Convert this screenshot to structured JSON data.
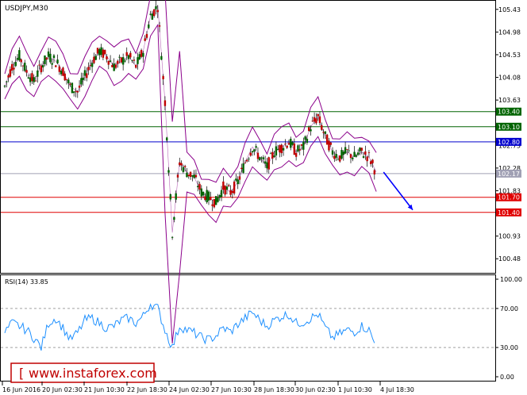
{
  "chart_data": [
    {
      "type": "candlestick",
      "title": "USDJPY,M30",
      "ylim": [
        100.2,
        105.6
      ],
      "y_ticks": [
        "105.43",
        "104.98",
        "104.53",
        "104.08",
        "103.63",
        "102.73",
        "102.28",
        "101.83",
        "100.93",
        "100.48"
      ],
      "price_levels": [
        {
          "label": "103.40",
          "value": 103.4,
          "role": "resistance",
          "color": "#006400"
        },
        {
          "label": "103.10",
          "value": 103.1,
          "role": "resistance",
          "color": "#006400"
        },
        {
          "label": "102.80",
          "value": 102.8,
          "role": "pivot",
          "color": "#0000cd"
        },
        {
          "label": "102.17",
          "value": 102.17,
          "role": "current",
          "color": "#a0a0b4"
        },
        {
          "label": "101.70",
          "value": 101.7,
          "role": "support",
          "color": "#e00000"
        },
        {
          "label": "101.40",
          "value": 101.4,
          "role": "support",
          "color": "#e00000"
        }
      ],
      "close_path": [
        [
          0,
          103.9
        ],
        [
          1,
          104.3
        ],
        [
          2,
          104.5
        ],
        [
          3,
          104.2
        ],
        [
          4,
          104.0
        ],
        [
          5,
          104.3
        ],
        [
          6,
          104.5
        ],
        [
          7,
          104.4
        ],
        [
          8,
          104.2
        ],
        [
          9,
          103.9
        ],
        [
          10,
          103.8
        ],
        [
          11,
          104.1
        ],
        [
          12,
          104.4
        ],
        [
          13,
          104.6
        ],
        [
          14,
          104.5
        ],
        [
          15,
          104.3
        ],
        [
          16,
          104.4
        ],
        [
          17,
          104.5
        ],
        [
          18,
          104.3
        ],
        [
          19,
          104.6
        ],
        [
          20,
          105.3
        ],
        [
          21,
          105.5
        ],
        [
          22,
          103.6
        ],
        [
          23,
          101.0
        ],
        [
          24,
          102.4
        ],
        [
          25,
          102.2
        ],
        [
          26,
          102.1
        ],
        [
          27,
          101.8
        ],
        [
          28,
          101.7
        ],
        [
          29,
          101.6
        ],
        [
          30,
          101.9
        ],
        [
          31,
          101.8
        ],
        [
          32,
          102.0
        ],
        [
          33,
          102.4
        ],
        [
          34,
          102.7
        ],
        [
          35,
          102.5
        ],
        [
          36,
          102.3
        ],
        [
          37,
          102.6
        ],
        [
          38,
          102.7
        ],
        [
          39,
          102.8
        ],
        [
          40,
          102.6
        ],
        [
          41,
          102.7
        ],
        [
          42,
          103.1
        ],
        [
          43,
          103.3
        ],
        [
          44,
          102.9
        ],
        [
          45,
          102.6
        ],
        [
          46,
          102.5
        ],
        [
          47,
          102.6
        ],
        [
          48,
          102.5
        ],
        [
          49,
          102.6
        ],
        [
          50,
          102.5
        ],
        [
          51,
          102.2
        ]
      ],
      "forecast_arrow": {
        "from": [
          52,
          102.2
        ],
        "to": [
          56,
          101.45
        ],
        "color": "#0000ff"
      },
      "indicator": "Bollinger Bands",
      "band_color": "#8b008b"
    },
    {
      "type": "line",
      "title": "RSI(14) 33.85",
      "ylim": [
        0,
        100
      ],
      "y_ticks": [
        "100.00",
        "70.00",
        "30.00",
        "0.00"
      ],
      "levels": [
        70,
        30
      ],
      "values": [
        45,
        55,
        52,
        48,
        40,
        30,
        55,
        60,
        50,
        38,
        45,
        58,
        60,
        55,
        50,
        52,
        58,
        60,
        55,
        62,
        75,
        70,
        48,
        30,
        52,
        48,
        45,
        40,
        38,
        42,
        50,
        46,
        54,
        60,
        66,
        58,
        52,
        58,
        62,
        64,
        55,
        56,
        60,
        64,
        50,
        40,
        44,
        48,
        46,
        52,
        48,
        30
      ],
      "color": "#1e90ff"
    }
  ],
  "x_axis": {
    "ticks": [
      "16 Jun 2016",
      "20 Jun 02:30",
      "21 Jun 10:30",
      "22 Jun 18:30",
      "24 Jun 02:30",
      "27 Jun 10:30",
      "28 Jun 18:30",
      "30 Jun 02:30",
      "1 Jul 10:30",
      "4 Jul 18:30"
    ]
  },
  "watermark": "www.instaforex.com"
}
